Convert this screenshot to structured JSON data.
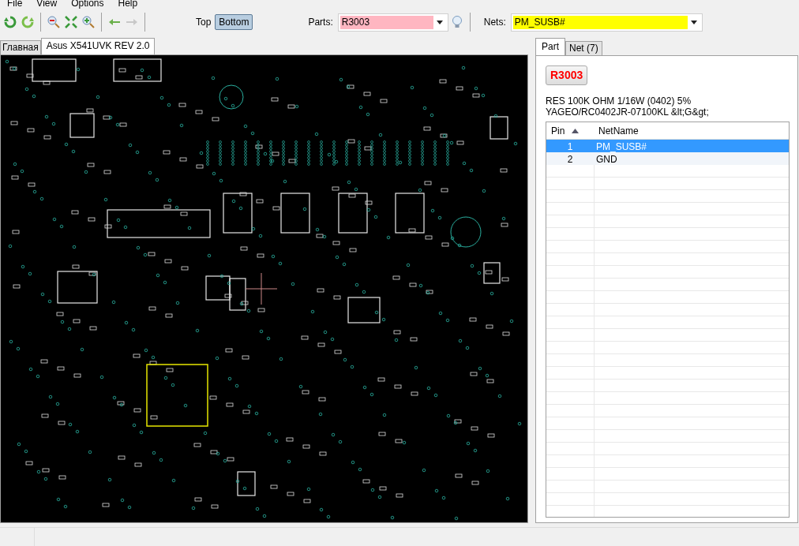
{
  "menu": [
    "File",
    "View",
    "Options",
    "Help"
  ],
  "side_toggle": [
    {
      "label": "Top",
      "selected": false
    },
    {
      "label": "Bottom",
      "selected": true
    }
  ],
  "parts": {
    "label": "Parts:",
    "value": "R3003"
  },
  "nets": {
    "label": "Nets:",
    "value": "PM_SUSB#"
  },
  "doc_tabs": [
    {
      "label": "Главная",
      "selected": false
    },
    {
      "label": "Asus X541UVK REV 2.0",
      "selected": true
    }
  ],
  "panel_tabs": [
    {
      "label": "Part",
      "selected": true
    },
    {
      "label": "Net (7)",
      "selected": false
    }
  ],
  "part": {
    "name": "R3003",
    "description": [
      "RES 100K OHM 1/16W (0402) 5%",
      "YAGEO/RC0402JR-07100KL &lt;G&gt;"
    ]
  },
  "pin_table": {
    "columns": [
      {
        "label": "Pin",
        "sorted": true
      },
      {
        "label": "NetName",
        "sorted": false
      }
    ],
    "rows": [
      {
        "pin": "1",
        "net": "PM_SUSB#",
        "selected": true
      },
      {
        "pin": "2",
        "net": "GND",
        "selected": false
      }
    ]
  }
}
